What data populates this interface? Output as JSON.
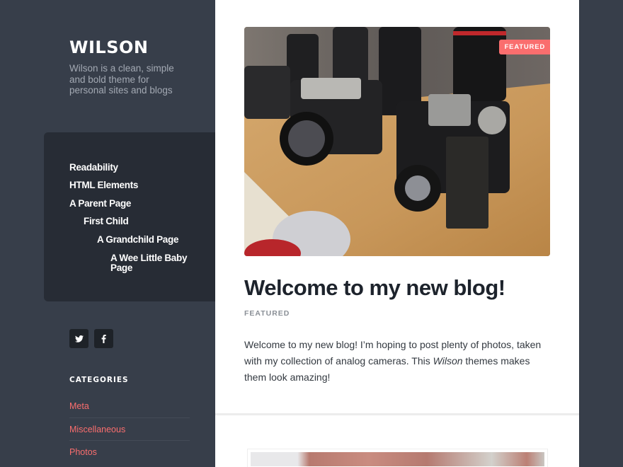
{
  "site": {
    "title": "WILSON",
    "description": "Wilson is a clean, simple and bold theme for personal sites and blogs"
  },
  "nav": {
    "items": [
      {
        "label": "Readability",
        "level": 0
      },
      {
        "label": "HTML Elements",
        "level": 0
      },
      {
        "label": "A Parent Page",
        "level": 0
      },
      {
        "label": "First Child",
        "level": 1
      },
      {
        "label": "A Grandchild Page",
        "level": 2
      },
      {
        "label": "A Wee Little Baby Page",
        "level": 3
      }
    ]
  },
  "social": [
    {
      "name": "twitter",
      "icon": "twitter-icon"
    },
    {
      "name": "facebook",
      "icon": "facebook-icon"
    }
  ],
  "categories_widget": {
    "title": "CATEGORIES",
    "items": [
      "Meta",
      "Miscellaneous",
      "Photos"
    ]
  },
  "post": {
    "badge": "FEATURED",
    "title": "Welcome to my new blog!",
    "category": "FEATURED",
    "excerpt_before": "Welcome to my new blog! I’m hoping to post plenty of photos, taken with my collection of analog cameras. This ",
    "excerpt_em": "Wilson",
    "excerpt_after": " themes makes them look amazing!",
    "image_alt": "Vintage cameras on a wooden shelf"
  },
  "colors": {
    "accent": "#fa6e6e",
    "sidebar_bg": "#373e4a",
    "nav_bg": "#272c35",
    "content_bg": "#ffffff",
    "title_text": "#1d232c"
  }
}
